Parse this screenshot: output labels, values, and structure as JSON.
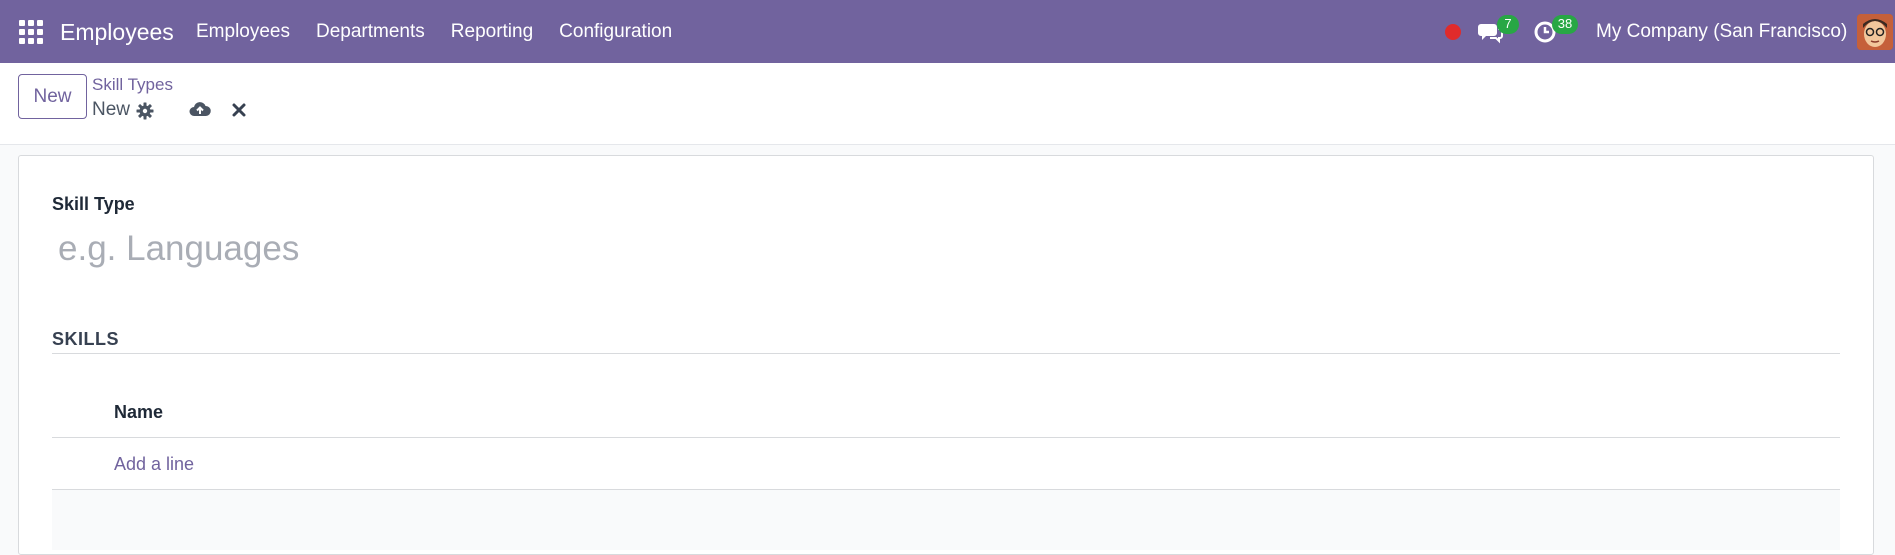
{
  "navbar": {
    "app_title": "Employees",
    "menu": [
      {
        "label": "Employees"
      },
      {
        "label": "Departments"
      },
      {
        "label": "Reporting"
      },
      {
        "label": "Configuration"
      }
    ],
    "chat_count": "7",
    "activity_count": "38",
    "company": "My Company (San Francisco)",
    "colors": {
      "bar": "#71639e",
      "badge": "#28a745",
      "record": "#e02b2b"
    }
  },
  "control_panel": {
    "new_label": "New",
    "breadcrumb_parent": "Skill Types",
    "breadcrumb_current": "New"
  },
  "form": {
    "skill_type_label": "Skill Type",
    "skill_type_value": "",
    "skill_type_placeholder": "e.g. Languages",
    "skills_section": "SKILLS",
    "columns": [
      {
        "label": "Name"
      }
    ],
    "add_line_label": "Add a line"
  }
}
